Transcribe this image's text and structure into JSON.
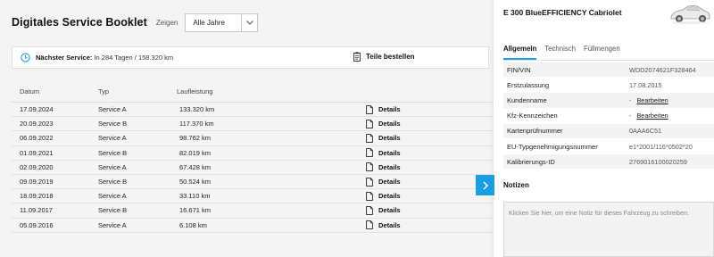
{
  "header": {
    "title": "Digitales Service Booklet",
    "filter_label": "Zeigen",
    "filter_value": "Alle Jahre"
  },
  "next_service": {
    "label": "Nächster Service:",
    "value": "In 284 Tagen / 158.320 km",
    "order_label": "Teile bestellen"
  },
  "table": {
    "columns": [
      "Datum",
      "Typ",
      "Laufleistung"
    ],
    "rows": [
      {
        "date": "17.09.2024",
        "type": "Service A",
        "mileage": "133.320 km",
        "action": "Details"
      },
      {
        "date": "20.09.2023",
        "type": "Service B",
        "mileage": "117.370 km",
        "action": "Details"
      },
      {
        "date": "06.09.2022",
        "type": "Service A",
        "mileage": "98.762 km",
        "action": "Details"
      },
      {
        "date": "01.09.2021",
        "type": "Service B",
        "mileage": "82.019 km",
        "action": "Details"
      },
      {
        "date": "02.09.2020",
        "type": "Service A",
        "mileage": "67.428 km",
        "action": "Details"
      },
      {
        "date": "09.09.2019",
        "type": "Service B",
        "mileage": "50.524 km",
        "action": "Details"
      },
      {
        "date": "18.09.2018",
        "type": "Service A",
        "mileage": "33.110 km",
        "action": "Details"
      },
      {
        "date": "11.09.2017",
        "type": "Service B",
        "mileage": "16.671 km",
        "action": "Details"
      },
      {
        "date": "05.09.2016",
        "type": "Service A",
        "mileage": "6.108 km",
        "action": "Details"
      }
    ]
  },
  "vehicle": {
    "title": "E 300 BlueEFFICIENCY Cabriolet",
    "tabs": [
      "Allgemein",
      "Technisch",
      "Füllmengen"
    ],
    "properties": [
      {
        "key": "FIN/VIN",
        "value": "WDD2074621F328464"
      },
      {
        "key": "Erstzulassung",
        "value": "17.08.2015"
      },
      {
        "key": "Kundenname",
        "value": "Bearbeiten",
        "dash": "-"
      },
      {
        "key": "Kfz-Kennzeichen",
        "value": "Bearbeiten",
        "dash": "-"
      },
      {
        "key": "Kartenprüfnummer",
        "value": "0AAA6C51"
      },
      {
        "key": "EU-Typgenehmigungsnummer",
        "value": "e1*2001/116*0502*20"
      },
      {
        "key": "Kalibrierungs-ID",
        "value": "2769016100020259"
      }
    ]
  },
  "notes": {
    "label": "Notizen",
    "placeholder": "Klicken Sie hier, um eine Notiz für dieses Fahrzeug zu schreiben."
  },
  "colors": {
    "accent": "#1b9ee0",
    "background": "#f4f4f4",
    "panel": "#ffffff"
  }
}
